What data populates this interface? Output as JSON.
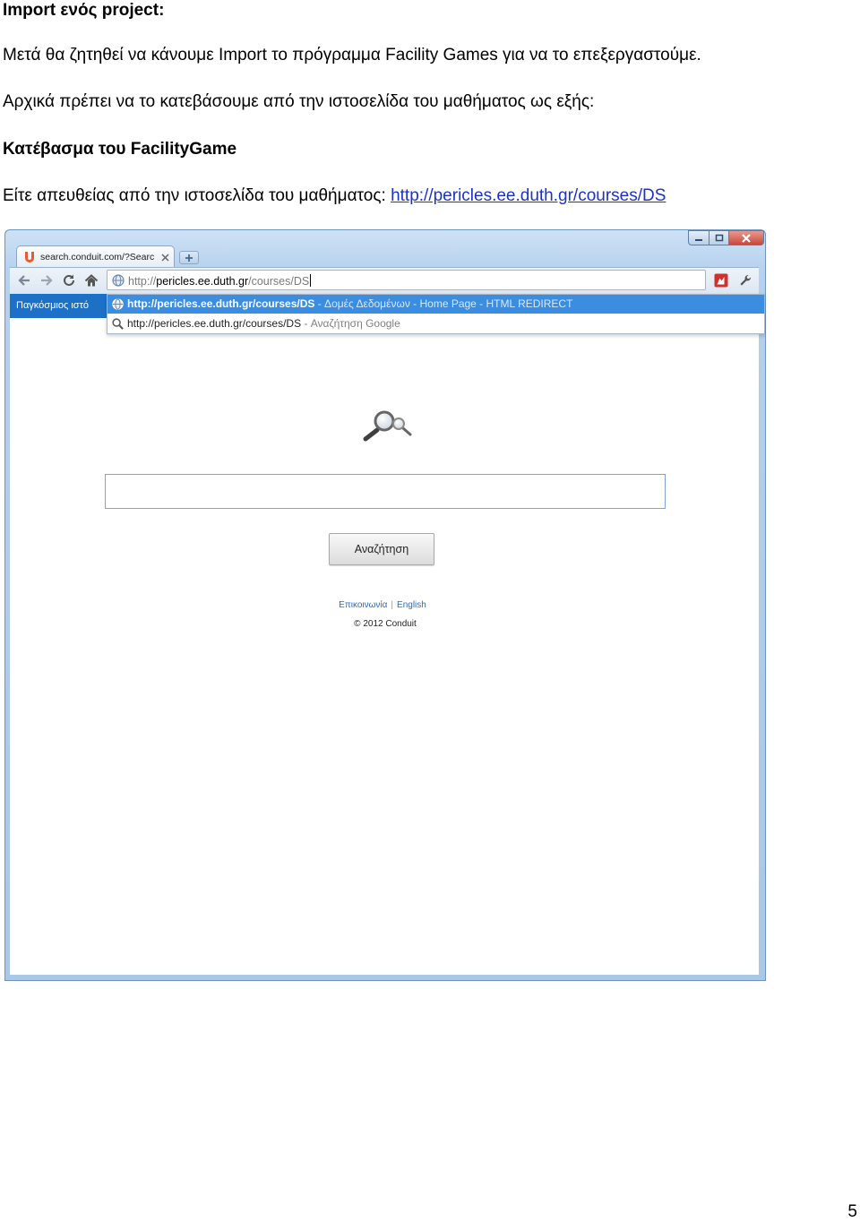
{
  "document": {
    "heading": "Import ενός project:",
    "paragraph1": "Μετά θα ζητηθεί να κάνουμε Import το πρόγραμμα Facility Games για να το επεξεργαστούμε.",
    "paragraph2": "Αρχικά πρέπει να το κατεβάσουμε από την ιστοσελίδα του μαθήματος ως εξής:",
    "subheading": "Κατέβασμα του FacilityGame",
    "paragraph3_prefix": "Είτε απευθείας από την ιστοσελίδα του μαθήματος: ",
    "paragraph3_link": "http://pericles.ee.duth.gr/courses/DS",
    "page_number": "5"
  },
  "browser": {
    "tab": {
      "title": "search.conduit.com/?Searc"
    },
    "address": {
      "scheme": "http://",
      "host": "pericles.ee.duth.gr",
      "path": "/courses/DS"
    },
    "conduit_toolbar": {
      "tab_label": "Παγκόσμιος ιστό"
    },
    "suggestions": [
      {
        "url": "http://pericles.ee.duth.gr/courses/DS",
        "description": " - Δομές Δεδομένων - Home Page - HTML REDIRECT",
        "icon": "globe-icon",
        "highlighted": true
      },
      {
        "url": "http://pericles.ee.duth.gr/courses/DS",
        "description": " - Αναζήτηση Google",
        "icon": "search-icon",
        "highlighted": false
      }
    ],
    "page": {
      "search_value": "",
      "search_button": "Αναζήτηση",
      "footer_links": [
        "Επικοινωνία",
        "English"
      ],
      "footer_separator": "|",
      "copyright": "© 2012 Conduit"
    }
  },
  "icons": {
    "back": "back-arrow-icon",
    "forward": "forward-arrow-icon",
    "reload": "reload-icon",
    "home": "home-icon",
    "address": "globe-icon",
    "extension": "extension-icon",
    "menu": "wrench-icon",
    "search_logo": "magnifier-icon",
    "favicon": "conduit-favicon-icon"
  },
  "colors": {
    "link": "#1a33c9",
    "frame": "#b3cfec",
    "hl": "#3b8de0",
    "ctab": "#1c71c6",
    "close": "#c9473d",
    "inborder": "#7aa7d6",
    "footlink": "#2b6cc0"
  }
}
